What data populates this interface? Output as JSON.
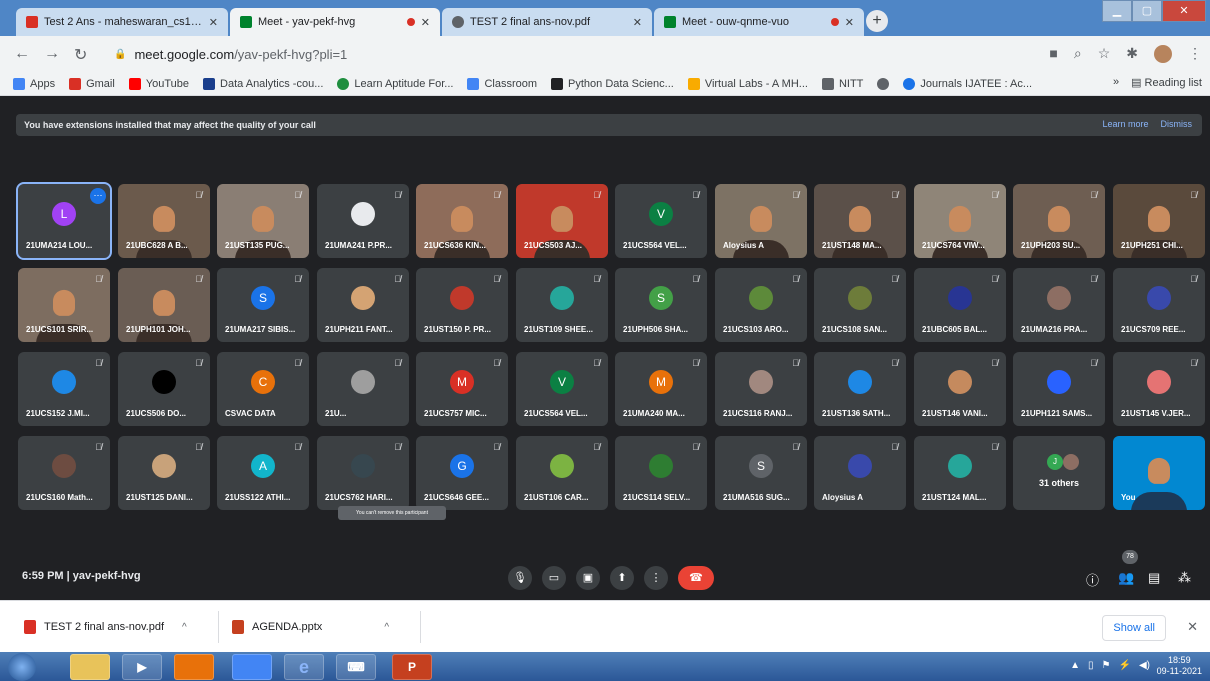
{
  "tabs": [
    {
      "title": "Test 2 Ans - maheswaran_cs1@m",
      "icon": "gmail-icon",
      "color": "#d93025",
      "recording": false,
      "active": false
    },
    {
      "title": "Meet - yav-pekf-hvg",
      "icon": "meet-icon",
      "color": "#00832d",
      "recording": true,
      "active": true
    },
    {
      "title": "TEST 2 final ans-nov.pdf",
      "icon": "globe-icon",
      "color": "#5f6368",
      "recording": false,
      "active": false
    },
    {
      "title": "Meet - ouw-qnme-vuo",
      "icon": "meet-icon",
      "color": "#00832d",
      "recording": true,
      "active": false
    }
  ],
  "address": {
    "host": "meet.google.com",
    "path": "/yav-pekf-hvg?pli=1"
  },
  "bookmarks": [
    {
      "label": "Apps",
      "color": "#4285f4"
    },
    {
      "label": "Gmail",
      "color": "#d93025"
    },
    {
      "label": "YouTube",
      "color": "#ff0000"
    },
    {
      "label": "Data Analytics -cou...",
      "color": "#1a3e8c"
    },
    {
      "label": "Learn Aptitude For...",
      "color": "#1e8e3e"
    },
    {
      "label": "Classroom",
      "color": "#4285f4"
    },
    {
      "label": "Python Data Scienc...",
      "color": "#202124"
    },
    {
      "label": "Virtual Labs - A MH...",
      "color": "#f9ab00"
    },
    {
      "label": "NITT",
      "color": "#5f6368"
    },
    {
      "label": "",
      "color": "#5f6368"
    },
    {
      "label": "Journals IJATEE : Ac...",
      "color": "#1a73e8"
    }
  ],
  "bookmarks_more": "»",
  "reading_list": "Reading list",
  "banner": {
    "text": "You have extensions installed that may affect the quality of your call",
    "learn_more": "Learn more",
    "dismiss": "Dismiss"
  },
  "participants": [
    {
      "name": "21UMA214 LOU...",
      "type": "letter",
      "letter": "L",
      "color": "#a142f4"
    },
    {
      "name": "21UBC628 A B...",
      "type": "video",
      "color": "#6b5a4c"
    },
    {
      "name": "21UST135 PUG...",
      "type": "video",
      "color": "#8a7e74"
    },
    {
      "name": "21UMA241 P.PR...",
      "type": "photo",
      "color": "#e8eaed"
    },
    {
      "name": "21UCS636 KIN...",
      "type": "video",
      "color": "#8e6c5a"
    },
    {
      "name": "21UCS503 AJ...",
      "type": "video",
      "color": "#c0392b"
    },
    {
      "name": "21UCS564 VEL...",
      "type": "letter",
      "letter": "V",
      "color": "#0b8043"
    },
    {
      "name": "Aloysius A",
      "type": "video",
      "color": "#7d7264"
    },
    {
      "name": "21UST148 MA...",
      "type": "video",
      "color": "#5b5049"
    },
    {
      "name": "21UCS764 VIW...",
      "type": "video",
      "color": "#8f8578"
    },
    {
      "name": "21UPH203 SU...",
      "type": "video",
      "color": "#6e5e52"
    },
    {
      "name": "21UPH251 CHI...",
      "type": "video",
      "color": "#5a4a3c"
    },
    {
      "name": "21UCS101 SRIR...",
      "type": "video",
      "color": "#7d6d60"
    },
    {
      "name": "21UPH101 JOH...",
      "type": "video",
      "color": "#6a5d54"
    },
    {
      "name": "21UMA217 SIBIS...",
      "type": "letter",
      "letter": "S",
      "color": "#1a73e8"
    },
    {
      "name": "21UPH211 FANT...",
      "type": "photo",
      "color": "#d4a373"
    },
    {
      "name": "21UST150 P. PR...",
      "type": "photo",
      "color": "#c0392b"
    },
    {
      "name": "21UST109 SHEE...",
      "type": "photo",
      "color": "#26a69a"
    },
    {
      "name": "21UPH506 SHA...",
      "type": "letter",
      "letter": "S",
      "color": "#43a047"
    },
    {
      "name": "21UCS103 ARO...",
      "type": "photo",
      "color": "#5d8a3a"
    },
    {
      "name": "21UCS108 SAN...",
      "type": "photo",
      "color": "#6d7c3a"
    },
    {
      "name": "21UBC605 BAL...",
      "type": "photo",
      "color": "#283593"
    },
    {
      "name": "21UMA216 PRA...",
      "type": "photo",
      "color": "#8d6e63"
    },
    {
      "name": "21UCS709 REE...",
      "type": "photo",
      "color": "#3949ab"
    },
    {
      "name": "21UCS152 J.MI...",
      "type": "photo",
      "color": "#1e88e5"
    },
    {
      "name": "21UCS506 DO...",
      "type": "photo",
      "color": "#000000"
    },
    {
      "name": "CSVAC DATA",
      "type": "letter",
      "letter": "C",
      "color": "#e8710a"
    },
    {
      "name": "21U...",
      "type": "photo",
      "color": "#9e9e9e"
    },
    {
      "name": "21UCS757 MIC...",
      "type": "letter",
      "letter": "M",
      "color": "#d93025"
    },
    {
      "name": "21UCS564 VEL...",
      "type": "letter",
      "letter": "V",
      "color": "#0b8043"
    },
    {
      "name": "21UMA240 MA...",
      "type": "letter",
      "letter": "M",
      "color": "#e8710a"
    },
    {
      "name": "21UCS116 RANJ...",
      "type": "photo",
      "color": "#a1887f"
    },
    {
      "name": "21UST136 SATH...",
      "type": "photo",
      "color": "#1e88e5"
    },
    {
      "name": "21UST146 VANI...",
      "type": "photo",
      "color": "#c58a5e"
    },
    {
      "name": "21UPH121 SAMS...",
      "type": "photo",
      "color": "#2962ff"
    },
    {
      "name": "21UST145 V.JER...",
      "type": "photo",
      "color": "#e57373"
    },
    {
      "name": "21UCS160 Math...",
      "type": "photo",
      "color": "#6d4c41"
    },
    {
      "name": "21UST125 DANI...",
      "type": "photo",
      "color": "#c8a27a"
    },
    {
      "name": "21USS122 ATHI...",
      "type": "letter",
      "letter": "A",
      "color": "#12b5cb"
    },
    {
      "name": "21UCS762 HARI...",
      "type": "photo",
      "color": "#37474f"
    },
    {
      "name": "21UCS646 GEE...",
      "type": "letter",
      "letter": "G",
      "color": "#1a73e8"
    },
    {
      "name": "21UST106 CAR...",
      "type": "photo",
      "color": "#7cb342"
    },
    {
      "name": "21UCS114 SELV...",
      "type": "photo",
      "color": "#2e7d32"
    },
    {
      "name": "21UMA516 SUG...",
      "type": "letter",
      "letter": "S",
      "color": "#5f6368"
    },
    {
      "name": "Aloysius A",
      "type": "photo",
      "color": "#3949ab"
    },
    {
      "name": "21UST124 MAL...",
      "type": "photo",
      "color": "#26a69a"
    },
    {
      "name": "31 others",
      "type": "others",
      "letter": "J",
      "color": "#34a853"
    },
    {
      "name": "You",
      "type": "self",
      "color": "#0288d1"
    }
  ],
  "tooltip": "You can't remove this participant",
  "meeting_info": "6:59 PM  |  yav-pekf-hvg",
  "participant_count": "78",
  "downloads": [
    {
      "name": "TEST 2 final ans-nov.pdf",
      "color": "#d93025"
    },
    {
      "name": "AGENDA.pptx",
      "color": "#c5401f"
    }
  ],
  "show_all": "Show all",
  "taskbar": {
    "time": "18:59",
    "date": "09-11-2021"
  }
}
